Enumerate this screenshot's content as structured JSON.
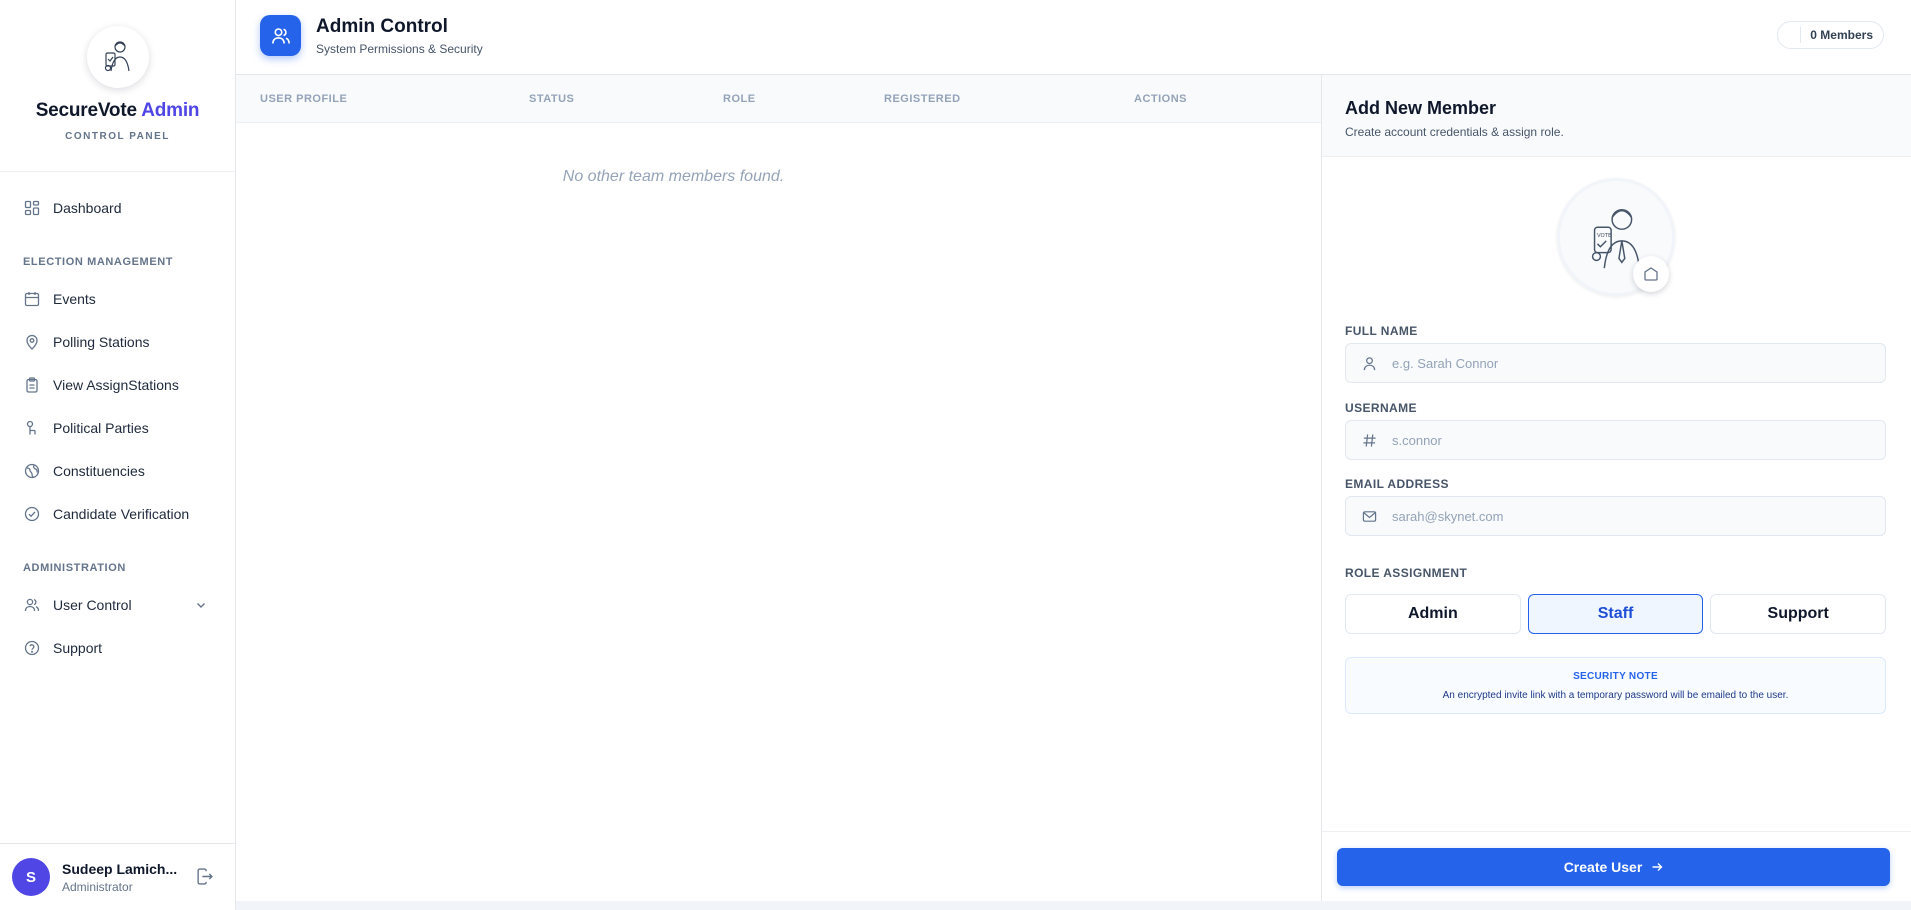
{
  "brand": {
    "name": "SecureVote",
    "name_accent": "Admin",
    "subtitle": "CONTROL PANEL"
  },
  "nav": {
    "dashboard": "Dashboard",
    "section_election": "ELECTION MANAGEMENT",
    "events": "Events",
    "polling_stations": "Polling Stations",
    "assign_stations": "View AssignStations",
    "political_parties": "Political Parties",
    "constituencies": "Constituencies",
    "candidate_verification": "Candidate Verification",
    "section_admin": "ADMINISTRATION",
    "user_control": "User Control",
    "support": "Support"
  },
  "user": {
    "initial": "S",
    "name": "Sudeep Lamich...",
    "role": "Administrator"
  },
  "header": {
    "title": "Admin Control",
    "subtitle": "System Permissions & Security",
    "members_count": "0 Members"
  },
  "table": {
    "columns": [
      "USER PROFILE",
      "STATUS",
      "ROLE",
      "REGISTERED",
      "ACTIONS"
    ],
    "empty_message": "No other team members found."
  },
  "form": {
    "title": "Add New Member",
    "subtitle": "Create account credentials & assign role.",
    "full_name_label": "FULL NAME",
    "full_name_placeholder": "e.g. Sarah Connor",
    "username_label": "USERNAME",
    "username_placeholder": "s.connor",
    "email_label": "EMAIL ADDRESS",
    "email_placeholder": "sarah@skynet.com",
    "role_label": "ROLE ASSIGNMENT",
    "roles": [
      "Admin",
      "Staff",
      "Support"
    ],
    "selected_role": "Staff",
    "security_title": "SECURITY NOTE",
    "security_text": "An encrypted invite link with a temporary password will be emailed to the user.",
    "submit_label": "Create User",
    "avatar_badge_text": "VOTE"
  },
  "colors": {
    "primary": "#2563eb",
    "accent": "#4f46e5",
    "muted": "#94a3b8"
  }
}
